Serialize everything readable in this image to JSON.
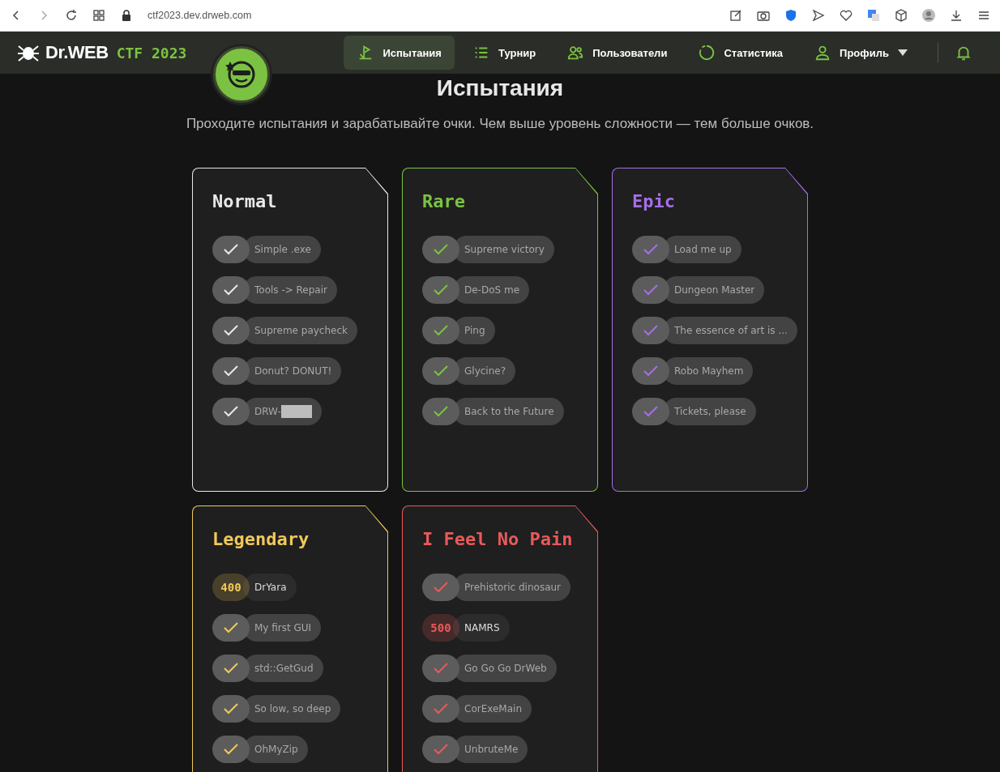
{
  "browser": {
    "url": "ctf2023.dev.drweb.com"
  },
  "header": {
    "logo": "Dr.WEB",
    "event": "CTF 2023",
    "nav": [
      {
        "label": "Испытания",
        "kind": "flag",
        "selected": true
      },
      {
        "label": "Турнир",
        "kind": "list",
        "selected": false
      },
      {
        "label": "Пользователи",
        "kind": "users",
        "selected": false
      },
      {
        "label": "Статистика",
        "kind": "ring",
        "selected": false
      },
      {
        "label": "Профиль",
        "kind": "user",
        "selected": false,
        "dropdown": true
      }
    ]
  },
  "page": {
    "title": "Испытания",
    "subtitle": "Проходите испытания и зарабатывайте очки. Чем выше уровень сложности — тем больше очков."
  },
  "cards": [
    {
      "title": "Normal",
      "color": "#e8e8e8",
      "challenges": [
        {
          "kind": "solved",
          "name": "Simple .exe"
        },
        {
          "kind": "solved",
          "name": "Tools -> Repair"
        },
        {
          "kind": "solved",
          "name": "Supreme paycheck"
        },
        {
          "kind": "solved",
          "name": "Donut? DONUT!"
        },
        {
          "kind": "solved",
          "name": "DRW-",
          "redacted": true
        }
      ]
    },
    {
      "title": "Rare",
      "color": "#7cc242",
      "challenges": [
        {
          "kind": "solved",
          "name": "Supreme victory"
        },
        {
          "kind": "solved",
          "name": "De-DoS me"
        },
        {
          "kind": "solved",
          "name": "Ping"
        },
        {
          "kind": "solved",
          "name": "Glycine?"
        },
        {
          "kind": "solved",
          "name": "Back to the Future"
        }
      ]
    },
    {
      "title": "Epic",
      "color": "#a66ee8",
      "challenges": [
        {
          "kind": "solved",
          "name": "Load me up"
        },
        {
          "kind": "solved",
          "name": "Dungeon Master"
        },
        {
          "kind": "solved",
          "name": "The essence of art is ..."
        },
        {
          "kind": "solved",
          "name": "Robo Mayhem"
        },
        {
          "kind": "solved",
          "name": "Tickets, please"
        }
      ]
    },
    {
      "title": "Legendary",
      "color": "#f0c95a",
      "challenges": [
        {
          "kind": "points",
          "points": "400",
          "name": "DrYara"
        },
        {
          "kind": "solved",
          "name": "My first GUI"
        },
        {
          "kind": "solved",
          "name": "std::GetGud"
        },
        {
          "kind": "solved",
          "name": "So low, so deep"
        },
        {
          "kind": "solved",
          "name": "OhMyZip"
        }
      ]
    },
    {
      "title": "I Feel No Pain",
      "color": "#e85a5a",
      "challenges": [
        {
          "kind": "solved",
          "name": "Prehistoric dinosaur"
        },
        {
          "kind": "points",
          "points": "500",
          "name": "NAMRS"
        },
        {
          "kind": "solved",
          "name": "Go Go Go DrWeb"
        },
        {
          "kind": "solved",
          "name": "CorExeMain"
        },
        {
          "kind": "solved",
          "name": "UnbruteMe"
        }
      ]
    }
  ]
}
